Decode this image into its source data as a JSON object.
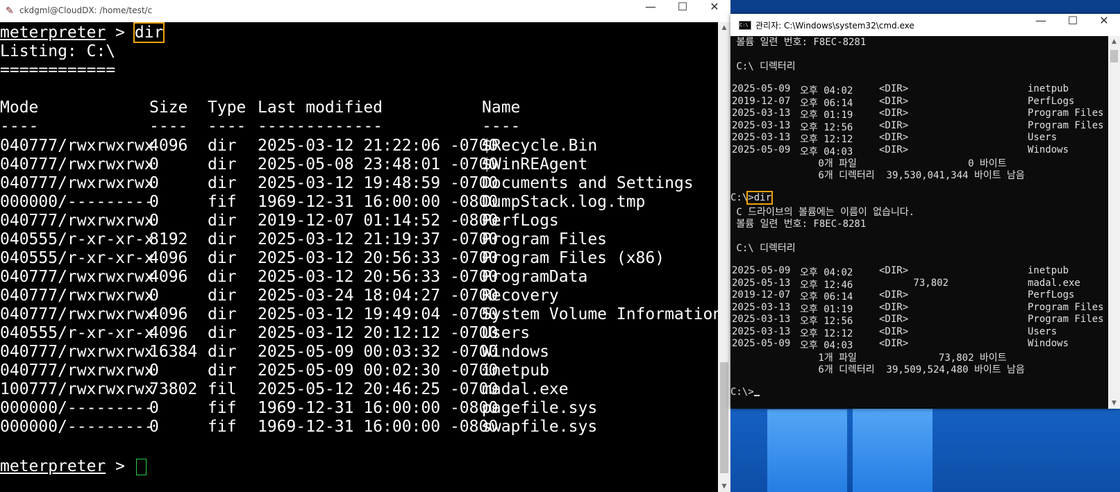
{
  "terminal": {
    "title": "ckdgml@CloudDX: /home/test/c",
    "prompt": "meterpreter",
    "prompt_sep": " > ",
    "command": "dir",
    "listing": "Listing: C:\\",
    "separator": "============",
    "headers": {
      "mode": "Mode",
      "size": "Size",
      "type": "Type",
      "last": "Last modified",
      "name": "Name"
    },
    "header_rules": {
      "mode": "----",
      "size": "----",
      "type": "----",
      "last": "-------------",
      "name": "----"
    },
    "rows": [
      {
        "mode": "040777/rwxrwxrwx",
        "size": "4096",
        "type": "dir",
        "last": "2025-03-12 21:22:06 -0700",
        "name": "$Recycle.Bin"
      },
      {
        "mode": "040777/rwxrwxrwx",
        "size": "0",
        "type": "dir",
        "last": "2025-05-08 23:48:01 -0700",
        "name": "$WinREAgent"
      },
      {
        "mode": "040777/rwxrwxrwx",
        "size": "0",
        "type": "dir",
        "last": "2025-03-12 19:48:59 -0700",
        "name": "Documents and Settings"
      },
      {
        "mode": "000000/---------",
        "size": "0",
        "type": "fif",
        "last": "1969-12-31 16:00:00 -0800",
        "name": "DumpStack.log.tmp"
      },
      {
        "mode": "040777/rwxrwxrwx",
        "size": "0",
        "type": "dir",
        "last": "2019-12-07 01:14:52 -0800",
        "name": "PerfLogs"
      },
      {
        "mode": "040555/r-xr-xr-x",
        "size": "8192",
        "type": "dir",
        "last": "2025-03-12 21:19:37 -0700",
        "name": "Program Files"
      },
      {
        "mode": "040555/r-xr-xr-x",
        "size": "4096",
        "type": "dir",
        "last": "2025-03-12 20:56:33 -0700",
        "name": "Program Files (x86)"
      },
      {
        "mode": "040777/rwxrwxrwx",
        "size": "4096",
        "type": "dir",
        "last": "2025-03-12 20:56:33 -0700",
        "name": "ProgramData"
      },
      {
        "mode": "040777/rwxrwxrwx",
        "size": "0",
        "type": "dir",
        "last": "2025-03-24 18:04:27 -0700",
        "name": "Recovery"
      },
      {
        "mode": "040777/rwxrwxrwx",
        "size": "4096",
        "type": "dir",
        "last": "2025-03-12 19:49:04 -0700",
        "name": "System Volume Information"
      },
      {
        "mode": "040555/r-xr-xr-x",
        "size": "4096",
        "type": "dir",
        "last": "2025-03-12 20:12:12 -0700",
        "name": "Users"
      },
      {
        "mode": "040777/rwxrwxrwx",
        "size": "16384",
        "type": "dir",
        "last": "2025-05-09 00:03:32 -0700",
        "name": "Windows"
      },
      {
        "mode": "040777/rwxrwxrwx",
        "size": "0",
        "type": "dir",
        "last": "2025-05-09 00:02:30 -0700",
        "name": "inetpub"
      },
      {
        "mode": "100777/rwxrwxrwx",
        "size": "73802",
        "type": "fil",
        "last": "2025-05-12 20:46:25 -0700",
        "name": "madal.exe"
      },
      {
        "mode": "000000/---------",
        "size": "0",
        "type": "fif",
        "last": "1969-12-31 16:00:00 -0800",
        "name": "pagefile.sys"
      },
      {
        "mode": "000000/---------",
        "size": "0",
        "type": "fif",
        "last": "1969-12-31 16:00:00 -0800",
        "name": "swapfile.sys"
      }
    ]
  },
  "cmd": {
    "title": "관리자: C:\\Windows\\system32\\cmd.exe",
    "icon_text": "C:\\",
    "serial_line": " 볼륨 일련 번호: F8EC-8281",
    "dir_header": " C:\\ 디렉터리",
    "listing1": [
      {
        "date": "2025-05-09",
        "time": "오후 04:02",
        "kind": "<DIR>",
        "size": "",
        "name": "inetpub"
      },
      {
        "date": "2019-12-07",
        "time": "오후 06:14",
        "kind": "<DIR>",
        "size": "",
        "name": "PerfLogs"
      },
      {
        "date": "2025-03-13",
        "time": "오후 01:19",
        "kind": "<DIR>",
        "size": "",
        "name": "Program Files"
      },
      {
        "date": "2025-03-13",
        "time": "오후 12:56",
        "kind": "<DIR>",
        "size": "",
        "name": "Program Files (x86)"
      },
      {
        "date": "2025-03-13",
        "time": "오후 12:12",
        "kind": "<DIR>",
        "size": "",
        "name": "Users"
      },
      {
        "date": "2025-05-09",
        "time": "오후 04:03",
        "kind": "<DIR>",
        "size": "",
        "name": "Windows"
      }
    ],
    "summary1_files": "               0개 파일                   0 바이트",
    "summary1_dirs": "               6개 디렉터리  39,530,041,344 바이트 남음",
    "prompt_path": "C:\\",
    "command": "dir",
    "no_label_line": " C 드라이브의 볼륨에는 이름이 없습니다.",
    "serial_line2": " 볼륨 일련 번호: F8EC-8281",
    "dir_header2": " C:\\ 디렉터리",
    "listing2": [
      {
        "date": "2025-05-09",
        "time": "오후 04:02",
        "kind": "<DIR>",
        "size": "",
        "name": "inetpub"
      },
      {
        "date": "2025-05-13",
        "time": "오후 12:46",
        "kind": "",
        "size": "73,802",
        "name": "madal.exe"
      },
      {
        "date": "2019-12-07",
        "time": "오후 06:14",
        "kind": "<DIR>",
        "size": "",
        "name": "PerfLogs"
      },
      {
        "date": "2025-03-13",
        "time": "오후 01:19",
        "kind": "<DIR>",
        "size": "",
        "name": "Program Files"
      },
      {
        "date": "2025-03-13",
        "time": "오후 12:56",
        "kind": "<DIR>",
        "size": "",
        "name": "Program Files (x86)"
      },
      {
        "date": "2025-03-13",
        "time": "오후 12:12",
        "kind": "<DIR>",
        "size": "",
        "name": "Users"
      },
      {
        "date": "2025-05-09",
        "time": "오후 04:03",
        "kind": "<DIR>",
        "size": "",
        "name": "Windows"
      }
    ],
    "summary2_files": "               1개 파일              73,802 바이트",
    "summary2_dirs": "               6개 디렉터리  39,509,524,480 바이트 남음",
    "final_prompt": "C:\\>"
  },
  "window_controls": {
    "minimize": "—",
    "maximize": "☐",
    "close": "✕"
  },
  "colors": {
    "highlight": "#f0a30a",
    "terminal_bg": "#000000",
    "cmd_bg": "#0c0c0c",
    "cursor": "#2ecc40"
  }
}
